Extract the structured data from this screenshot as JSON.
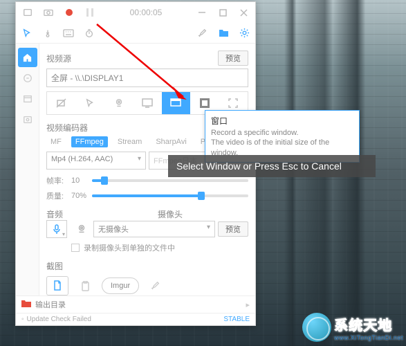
{
  "titlebar": {
    "timer": "00:00:05"
  },
  "sections": {
    "video_source": "视频源",
    "video_encoder": "视频编码器",
    "audio": "音频",
    "camera": "摄像头",
    "screenshot": "截图"
  },
  "preview_label": "预览",
  "display_text": "全屏 - \\\\.\\DISPLAY1",
  "encoder_tabs": [
    "MF",
    "FFmpeg",
    "Stream",
    "SharpAvi",
    "P"
  ],
  "encoder_active": "FFmpeg",
  "format_select": "Mp4 (H.264, AAC)",
  "format_placeholder": "FFmpeg日本",
  "framerate": {
    "label": "帧率:",
    "value": "10"
  },
  "quality": {
    "label": "质量:",
    "value": "70%"
  },
  "camera_select": "无摄像头",
  "camera_checkbox": "录制摄像头到单独的文件中",
  "screenshot_buttons": {
    "imgur": "Imgur"
  },
  "footer": {
    "output_label": "输出目录"
  },
  "status": {
    "message": "Update Check Failed",
    "channel": "STABLE"
  },
  "tooltip": {
    "title": "窗口",
    "line1": "Record a specific window.",
    "line2": "The video is of the initial size of the window."
  },
  "overlay": "Select Window or Press Esc to Cancel",
  "watermark": {
    "title": "系统天地",
    "url": "www.XiTongTianDi.net"
  }
}
